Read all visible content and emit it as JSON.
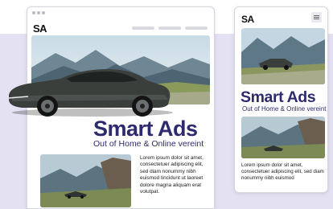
{
  "brand": {
    "logo": "SA"
  },
  "hero": {
    "headline": "Smart Ads",
    "subline": "Out of Home & Online vereint"
  },
  "body_text": "Lorem ipsum dolor sit amet, consectetuer adipiscing elit, sed diam nonummy nibh euismod tincidunt ut laoreet dolore magna aliquam erat volutpat.",
  "mobile_body_text": "Lorem ipsum dolor sit amet, consectetuer adipiscing elit, sed diam nonummy nibh euismod",
  "icons": [
    "window-dot-icon",
    "menu-icon"
  ],
  "colors": {
    "accent": "#2d2a6e",
    "band": "#e4e2f2",
    "car": "#3a3f3c"
  }
}
